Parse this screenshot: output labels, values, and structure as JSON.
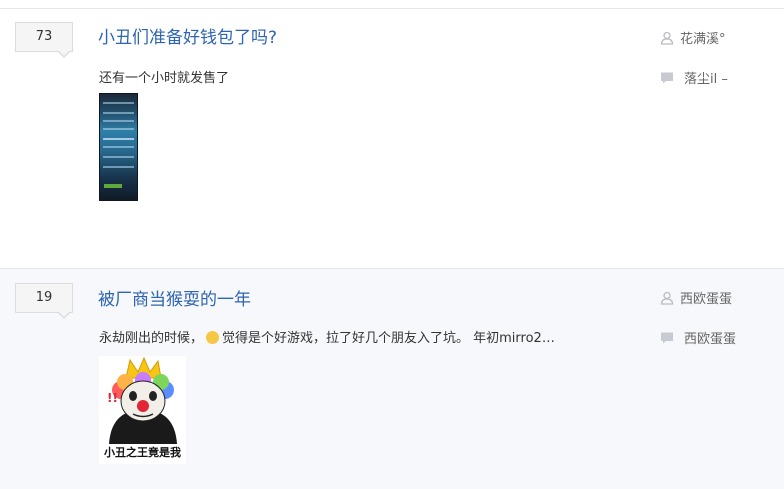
{
  "threads": [
    {
      "reply_count": "73",
      "title": "小丑们准备好钱包了吗?",
      "abstract": "还有一个小时就发售了",
      "author": "花满溪°",
      "last_reply": "落尘il –",
      "author_icon": "user-icon",
      "reply_icon": "comment-icon"
    },
    {
      "reply_count": "19",
      "title": "被厂商当猴耍的一年",
      "abstract_before": "永劫刚出的时候，",
      "abstract_after": "觉得是个好游戏，拉了好几个朋友入了坑。 年初mirro2…",
      "author": "西欧蛋蛋",
      "last_reply": "西欧蛋蛋",
      "meme_caption": "小丑之王竟是我",
      "author_icon": "user-icon",
      "reply_icon": "comment-icon"
    }
  ],
  "colors": {
    "title_link": "#2d64b3",
    "alt_row_bg": "#f7f8fb"
  }
}
